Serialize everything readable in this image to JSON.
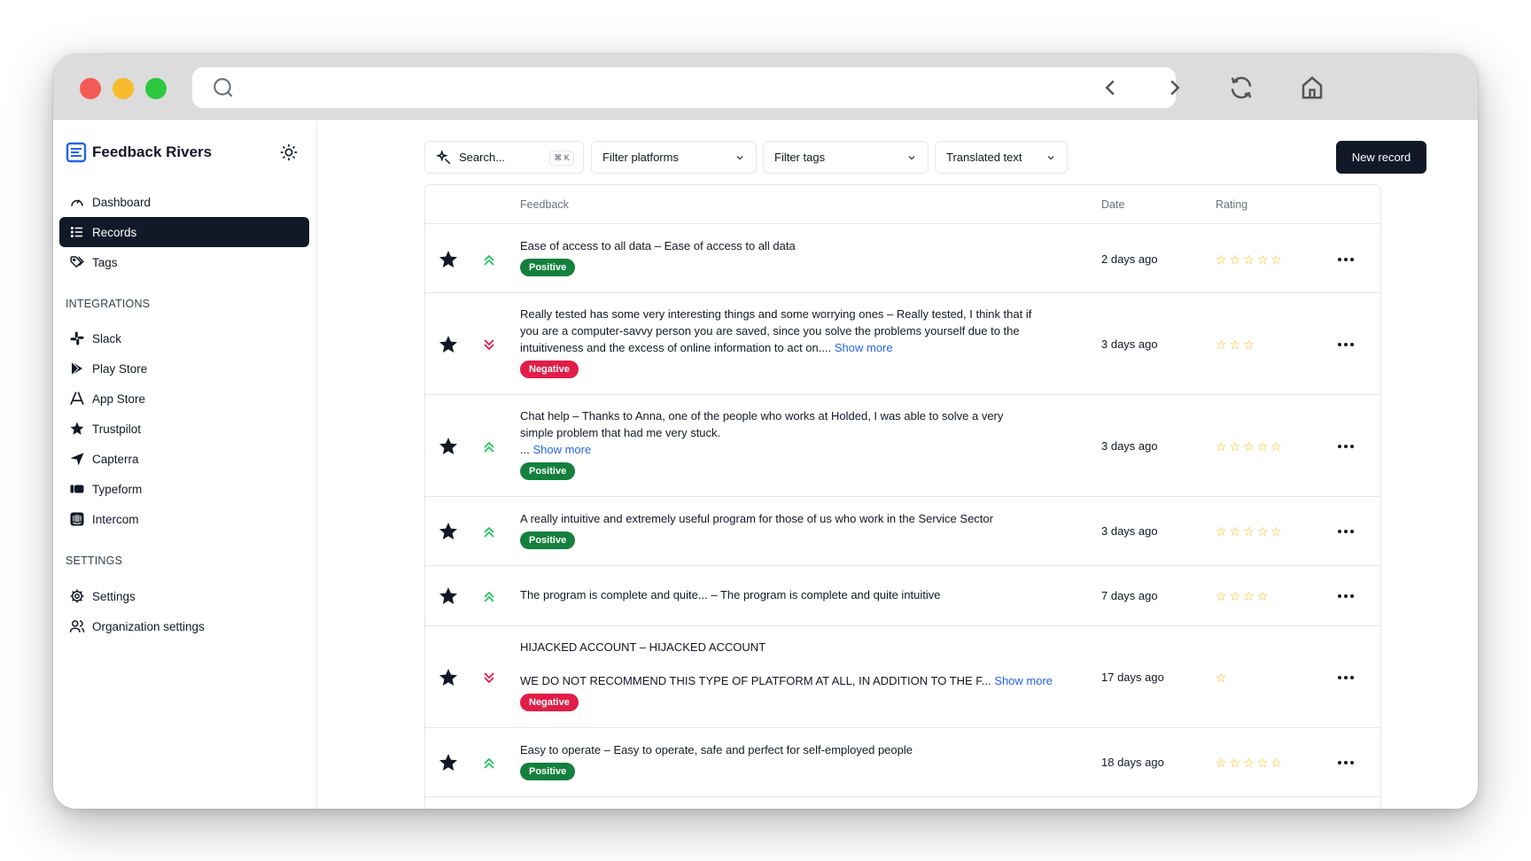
{
  "app": {
    "name": "Feedback Rivers"
  },
  "colors": {
    "accent": "#111827",
    "positive": "#15803d",
    "negative": "#e11d48",
    "link": "#2563eb",
    "star": "#f5b400",
    "brand": "#2563eb"
  },
  "sidebar": {
    "main_items": [
      {
        "label": "Dashboard",
        "icon": "gauge-icon",
        "active": false
      },
      {
        "label": "Records",
        "icon": "list-icon",
        "active": true
      },
      {
        "label": "Tags",
        "icon": "tags-icon",
        "active": false
      }
    ],
    "integrations_label": "INTEGRATIONS",
    "integrations": [
      {
        "label": "Slack",
        "icon": "slack-icon"
      },
      {
        "label": "Play Store",
        "icon": "play-store-icon"
      },
      {
        "label": "App Store",
        "icon": "app-store-icon"
      },
      {
        "label": "Trustpilot",
        "icon": "trustpilot-star-icon"
      },
      {
        "label": "Capterra",
        "icon": "capterra-icon"
      },
      {
        "label": "Typeform",
        "icon": "typeform-icon"
      },
      {
        "label": "Intercom",
        "icon": "intercom-icon"
      }
    ],
    "settings_label": "SETTINGS",
    "settings": [
      {
        "label": "Settings",
        "icon": "gear-icon"
      },
      {
        "label": "Organization settings",
        "icon": "users-icon"
      }
    ]
  },
  "toolbar": {
    "search_label": "Search...",
    "search_shortcut": "⌘ K",
    "filter_platforms": "Filter platforms",
    "filter_tags": "Filter tags",
    "translated": "Translated text",
    "new_record": "New record"
  },
  "table": {
    "headers": {
      "feedback": "Feedback",
      "date": "Date",
      "rating": "Rating"
    },
    "rows": [
      {
        "lines": [
          "Ease of access to all data – Ease of access to all data"
        ],
        "more": "",
        "sentiment": "Positive",
        "date": "2 days ago",
        "rating": 5
      },
      {
        "lines": [
          "Really tested has some very interesting things and some worrying ones – Really tested, I think that if",
          "you are a computer-savvy person you are saved, since you solve the problems yourself due to the",
          "intuitiveness and the excess of online information to act on...."
        ],
        "more": "Show more",
        "sentiment": "Negative",
        "date": "3 days ago",
        "rating": 3
      },
      {
        "lines": [
          "Chat help – Thanks to Anna, one of the people who works at Holded, I was able to solve a very",
          "simple problem that had me very stuck.",
          "..."
        ],
        "more": "Show more",
        "sentiment": "Positive",
        "date": "3 days ago",
        "rating": 5
      },
      {
        "lines": [
          "A really intuitive and extremely useful program for those of us who work in the Service Sector"
        ],
        "more": "",
        "sentiment": "Positive",
        "date": "3 days ago",
        "rating": 5
      },
      {
        "lines": [
          "The program is complete and quite... – The program is complete and quite intuitive"
        ],
        "more": "",
        "sentiment": "",
        "date": "7 days ago",
        "rating": 4
      },
      {
        "lines": [
          "HIJACKED ACCOUNT – HIJACKED ACCOUNT",
          "",
          "WE DO NOT RECOMMEND THIS TYPE OF PLATFORM AT ALL, IN ADDITION TO THE F..."
        ],
        "more": "Show more",
        "sentiment": "Negative",
        "date": "17 days ago",
        "rating": 1
      },
      {
        "lines": [
          "Easy to operate – Easy to operate, safe and perfect for self-employed people"
        ],
        "more": "",
        "sentiment": "Positive",
        "date": "18 days ago",
        "rating": 5
      }
    ]
  }
}
